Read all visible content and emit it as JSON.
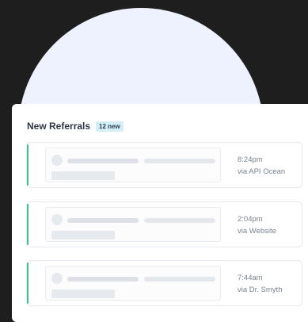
{
  "header": {
    "title": "New Referrals",
    "badge": "12 new"
  },
  "referrals": [
    {
      "time": "8:24pm",
      "source": "via API Ocean"
    },
    {
      "time": "2:04pm",
      "source": "via Website"
    },
    {
      "time": "7:44am",
      "source": "via Dr. Smyth"
    }
  ],
  "colors": {
    "background": "#1e1e1e",
    "circle": "#eef1fe",
    "accent": "#3fbf98",
    "badge_bg": "#d3eef7"
  }
}
